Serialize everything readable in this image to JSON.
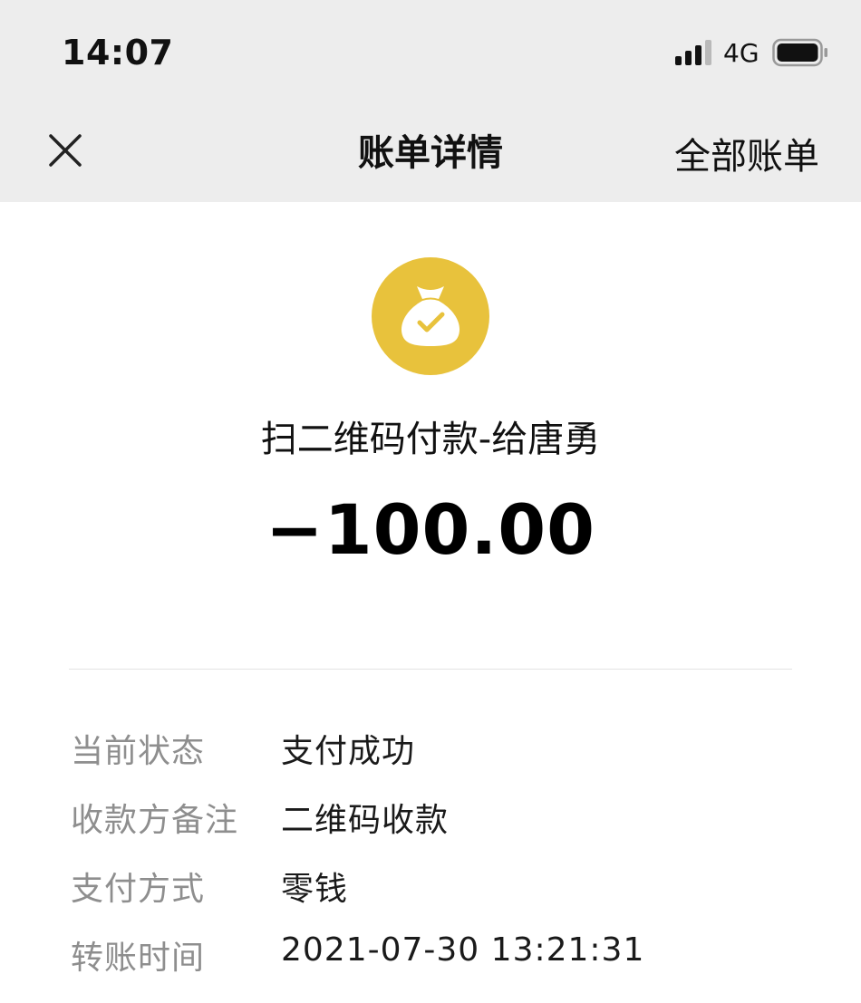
{
  "status_bar": {
    "time": "14:07",
    "network": "4G",
    "signal_icon": "cellular-signal-icon",
    "battery_icon": "battery-icon"
  },
  "nav": {
    "close_icon": "close-icon",
    "title": "账单详情",
    "right_label": "全部账单"
  },
  "summary": {
    "icon": "money-bag-check-icon",
    "icon_color": "#E8C23C",
    "merchant": "扫二维码付款-给唐勇",
    "amount": "−100.00"
  },
  "details": [
    {
      "label": "当前状态",
      "value": "支付成功"
    },
    {
      "label": "收款方备注",
      "value": "二维码收款"
    },
    {
      "label": "支付方式",
      "value": "零钱"
    },
    {
      "label": "转账时间",
      "value": "2021-07-30 13:21:31"
    }
  ]
}
